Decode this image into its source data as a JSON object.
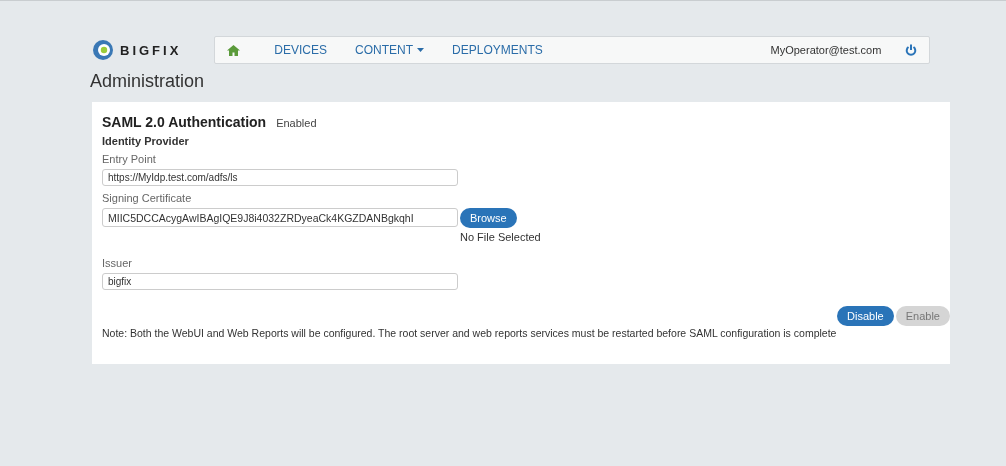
{
  "brand": "BIGFIX",
  "nav": {
    "items": [
      {
        "kind": "home"
      },
      {
        "kind": "link",
        "label": "DEVICES"
      },
      {
        "kind": "dropdown",
        "label": "CONTENT"
      },
      {
        "kind": "link",
        "label": "DEPLOYMENTS"
      }
    ],
    "user": "MyOperator@test.com"
  },
  "page_title": "Administration",
  "section": {
    "title": "SAML 2.0 Authentication",
    "status": "Enabled",
    "subtitle": "Identity Provider",
    "fields": [
      {
        "kind": "text",
        "label": "Entry Point",
        "value": "https://MyIdp.test.com/adfs/ls"
      },
      {
        "kind": "file",
        "label": "Signing Certificate",
        "value": "MIIC5DCCAcygAwIBAgIQE9J8i4032ZRDyeaCk4KGZDANBgkqhI",
        "button": "Browse",
        "file_status": "No File Selected"
      },
      {
        "kind": "text",
        "label": "Issuer",
        "value": "bigfix"
      }
    ],
    "buttons": [
      {
        "label": "Disable",
        "disabled": false
      },
      {
        "label": "Enable",
        "disabled": true
      }
    ],
    "note": "Note: Both the WebUI and Web Reports will be configured. The root server and web reports services must be restarted before SAML configuration is complete"
  }
}
